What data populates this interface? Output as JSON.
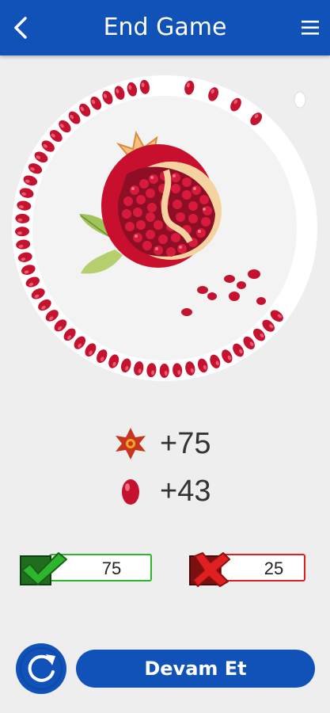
{
  "header": {
    "title": "End Game",
    "back_icon": "chevron-left-icon",
    "menu_icon": "hamburger-menu-icon",
    "color": "#1052b8"
  },
  "progress": {
    "icon": "pomegranate-icon",
    "seeds_shown": 43,
    "seed_color": "#c4122f"
  },
  "scores": {
    "flower_points": "+75",
    "flower_icon": "pomegranate-flower-icon",
    "seed_points": "+43",
    "seed_icon": "pomegranate-seed-icon"
  },
  "results": {
    "correct_count": "75",
    "correct_icon": "checkmark-icon",
    "correct_color": "#2db52d",
    "wrong_count": "25",
    "wrong_icon": "x-mark-icon",
    "wrong_color": "#e02020"
  },
  "actions": {
    "refresh_icon": "refresh-icon",
    "continue_label": "Devam Et"
  }
}
